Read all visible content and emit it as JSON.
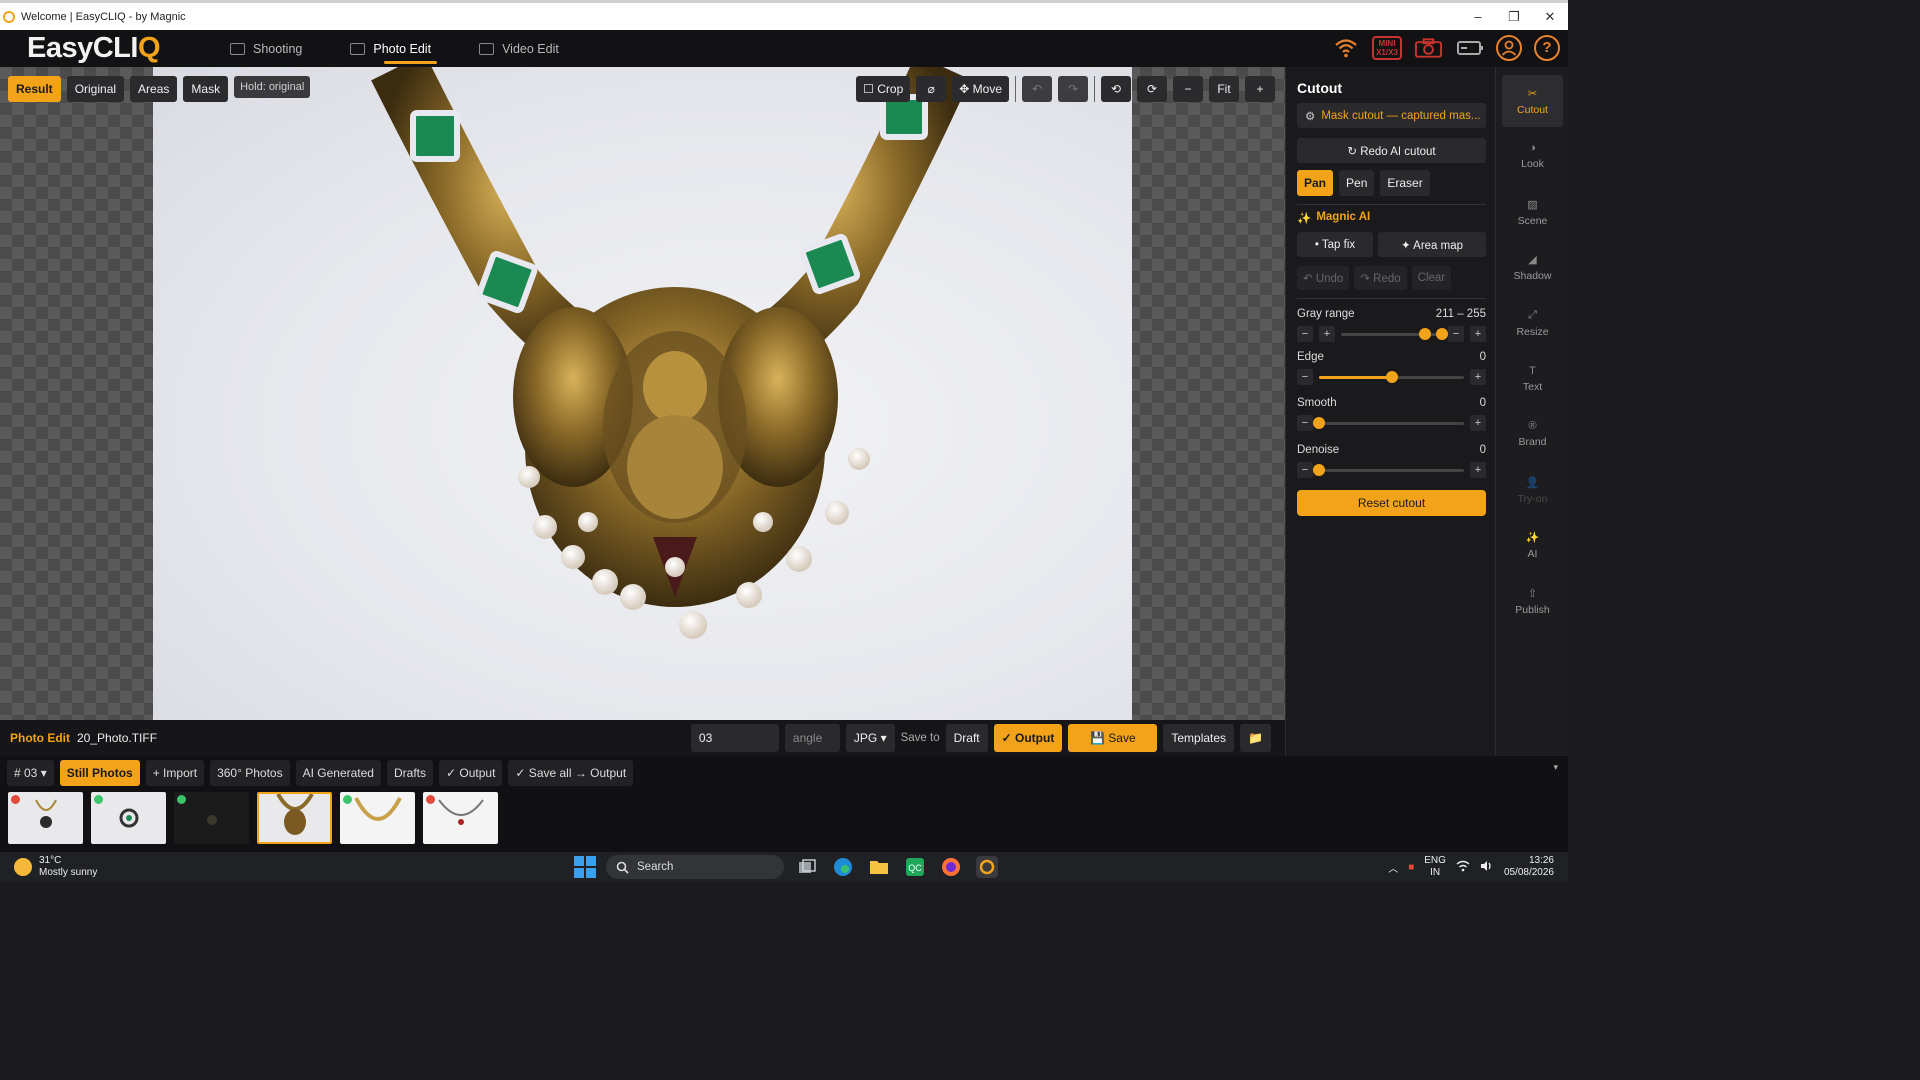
{
  "window": {
    "title": "Welcome | EasyCLIQ - by Magnic",
    "minimize": "–",
    "restore": "❐",
    "close": "✕"
  },
  "brand": {
    "text": "EasyCLI",
    "q": "Q"
  },
  "nav": [
    {
      "label": "Shooting",
      "icon": "camera-icon"
    },
    {
      "label": "Photo Edit",
      "icon": "edit-icon",
      "active": true
    },
    {
      "label": "Video Edit",
      "icon": "video-camera-icon"
    }
  ],
  "header_icons": {
    "wifi": "wifi-icon",
    "mini_badge": "MINI\nX1/X3",
    "camera": "camera-icon",
    "battery": "battery-icon",
    "account": "account-icon",
    "help": "?"
  },
  "view_buttons": [
    "Result",
    "Original",
    "Areas",
    "Mask"
  ],
  "hold_hint": "Hold: original",
  "tools": {
    "crop": "☐ Crop",
    "lasso": "⌀",
    "move": "✥ Move",
    "undo": "↶",
    "redo": "↷",
    "rotate_left": "⟲",
    "rotate_right": "⟳",
    "zoom_out": "−",
    "fit": "Fit",
    "zoom_in": "+"
  },
  "panel": {
    "title": "Cutout",
    "mask_status": "Mask cutout — captured mas...",
    "redo_ai": "↻ Redo AI cutout",
    "modes": [
      "Pan",
      "Pen",
      "Eraser"
    ],
    "active_mode": "Pan",
    "magnic_ai": "Magnic AI",
    "tap_fix": "• Tap fix",
    "area_map": "✦ Area map",
    "undo": "↶ Undo",
    "redo": "↷ Redo",
    "clear": "Clear",
    "sliders": [
      {
        "label": "Gray range",
        "value": "211 – 255",
        "low": 211,
        "high": 255,
        "max": 255
      },
      {
        "label": "Edge",
        "value": "0",
        "level": 0.5
      },
      {
        "label": "Smooth",
        "value": "0",
        "level": 0
      },
      {
        "label": "Denoise",
        "value": "0",
        "level": 0
      }
    ],
    "minus": "−",
    "plus": "+",
    "reset": "Reset cutout"
  },
  "rail": [
    {
      "label": "Cutout",
      "icon": "✂",
      "active": true
    },
    {
      "label": "Look",
      "icon": "◑"
    },
    {
      "label": "Scene",
      "icon": "▨"
    },
    {
      "label": "Shadow",
      "icon": "◢"
    },
    {
      "label": "Resize",
      "icon": "⤢"
    },
    {
      "label": "Text",
      "icon": "T"
    },
    {
      "label": "Brand",
      "icon": "®"
    },
    {
      "label": "Try-on",
      "icon": "👤",
      "disabled": true
    },
    {
      "label": "AI",
      "icon": "✨"
    },
    {
      "label": "Publish",
      "icon": "⇧"
    }
  ],
  "status_bar": {
    "mode": "Photo Edit",
    "filename": "20_Photo.TIFF",
    "number_value": "03",
    "angle_placeholder": "angle",
    "format": "JPG ▾",
    "save_to": "Save to",
    "draft": "Draft",
    "output": "✓ Output",
    "save": "💾 Save",
    "templates": "Templates",
    "folder": "📁"
  },
  "gallery": {
    "folder_select": "# 03 ▾",
    "tabs": [
      "Still Photos",
      "+ Import",
      "360° Photos",
      "AI Generated",
      "Drafts",
      "✓ Output",
      "✓ Save all → Output"
    ],
    "expand": "▾",
    "thumbnails": [
      {
        "status": "red",
        "selected": false
      },
      {
        "status": "green",
        "selected": false
      },
      {
        "status": "green",
        "selected": false,
        "dark": true
      },
      {
        "status": "none",
        "selected": true
      },
      {
        "status": "green",
        "selected": false
      },
      {
        "status": "red",
        "selected": false
      }
    ]
  },
  "taskbar": {
    "temp": "31°C",
    "condition": "Mostly sunny",
    "search": "Search",
    "lang1": "ENG",
    "lang2": "IN",
    "time": "13:26",
    "date": "05/08/2026"
  },
  "colors": {
    "accent": "#f2a31a",
    "bg": "#1b1b1d"
  }
}
